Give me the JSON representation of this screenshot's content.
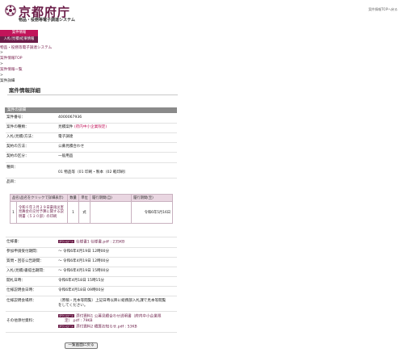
{
  "header": {
    "logo_text": "京都府庁",
    "system_title": "物品・役務等電子調達システム",
    "top_link": "案件情報TOPへ戻る"
  },
  "sidebar": {
    "items": [
      {
        "label": "案件情報"
      },
      {
        "label": "入札(見積)結果情報"
      }
    ]
  },
  "breadcrumb": {
    "items": [
      "物品・役務等電子調達システム",
      ">",
      "案件情報TOP",
      ">",
      "案件情報一覧",
      ">",
      "案件詳細"
    ]
  },
  "page": {
    "title": "案件情報詳細",
    "section_title": "案件の詳細"
  },
  "fields": {
    "case_no": {
      "label": "案件番号：",
      "value": "4000067936"
    },
    "case_type": {
      "label": "案件の種類：",
      "value": "見積案件",
      "note": "(府内中小企業限定)"
    },
    "bid_method": {
      "label": "入札(見積)方法：",
      "value": "電子調達"
    },
    "contract_method": {
      "label": "契約の方法：",
      "value": "公募見積合わせ"
    },
    "category": {
      "label": "契約の区分：",
      "value": "一般用品"
    },
    "type": {
      "label": "種目：",
      "value": "01 物品等（01 印刷・製本（02 軽印刷）"
    },
    "items_label": {
      "label": "品目："
    }
  },
  "items_table": {
    "headers": [
      "品名(品名をクリックで詳細表示)",
      "数量",
      "単位",
      "履行期間(自)",
      "履行期間(至)"
    ],
    "rows": [
      {
        "no": "1",
        "name": "令和６年３月２９日豪雨災害見舞金の交付予算に関する説明書（５２０部）の印刷",
        "qty": "1",
        "unit": "式",
        "from": "",
        "to": "令和6年5月16日"
      }
    ]
  },
  "details": {
    "spec": {
      "label": "仕様書：",
      "icon": "ダウンロード",
      "file": "仕様書1 仕様書.pdf : 235KB"
    },
    "apply_deadline": {
      "label": "参加申請受付期間：",
      "value": "〜 令和6年4月19日 12時00分"
    },
    "question_period": {
      "label": "質問・回答公告期間：",
      "value": "〜 令和6年4月19日 12時00分"
    },
    "bid_period": {
      "label": "入札(見積)書提出期間：",
      "value": "〜 令和6年4月19日 15時00分"
    },
    "opening_date": {
      "label": "開札日時：",
      "value": "令和6年4月18日 15時15分"
    },
    "briefing_date": {
      "label": "仕様説明会日時：",
      "value": "令和6年4月18日 09時00分"
    },
    "briefing_place": {
      "label": "仕様説明会場所：",
      "value_line1": "（原稿・見本等閲覧）上記日時以降に総務部入札課で見本等閲覧",
      "value_line2": "をしてください。"
    },
    "other_files": {
      "label": "その他添付資料：",
      "files": [
        {
          "icon": "ダウンロード",
          "file": "添付資料1 公募見積合わせ説明書（府内中小企業限",
          "file2": "定）.pdf : 79KB"
        },
        {
          "icon": "ダウンロード",
          "file": "添付資料2 積算お知らせ.pdf : 53KB"
        }
      ]
    }
  },
  "footer": {
    "back_button": "一覧画面に戻る"
  },
  "colors": {
    "brand": "#6b1d48",
    "accent": "#c2145a",
    "section_bar": "#8a8a8a",
    "table_header": "#e9d6e1"
  }
}
